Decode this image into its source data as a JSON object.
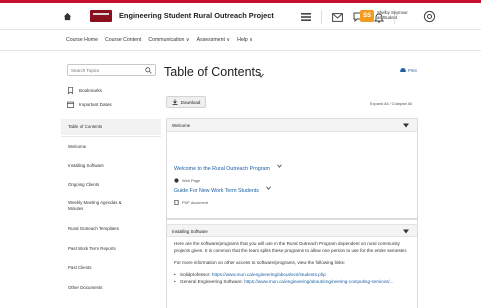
{
  "navbar": {
    "course_title": "Engineering Student Rural Outreach Project",
    "user_badge": "SS",
    "user_name": "Shelby Seymour",
    "user_role": "as Student"
  },
  "course_nav": {
    "items": [
      "Course Home",
      "Course Content",
      "Communication ∨",
      "Assessment ∨",
      "Help ∨"
    ]
  },
  "sidebar": {
    "search_placeholder": "Search Topics",
    "bookmarks": "Bookmarks",
    "important_dates": "Important Dates",
    "items": [
      {
        "label": "Table of Contents",
        "active": true
      },
      {
        "label": "Welcome"
      },
      {
        "label": "Installing Software"
      },
      {
        "label": "Ongoing Clients"
      },
      {
        "label": "Weekly Meeting Agendas & Minutes"
      },
      {
        "label": "Rural Outreach Templates"
      },
      {
        "label": "Past Work Term Reports"
      },
      {
        "label": "Past Clients"
      },
      {
        "label": "Other Documents"
      }
    ]
  },
  "main": {
    "title": "Table of Contents",
    "print": "Print",
    "download": "Download",
    "expand_collapse": "Expand All / Collapse All",
    "modules": [
      {
        "title": "Welcome",
        "topics": [
          {
            "title": "Welcome to the Rural Outreach Program",
            "meta": "Web Page"
          },
          {
            "title": "Guide For New Work Term Students",
            "meta": "PDF document"
          }
        ]
      },
      {
        "title": "Installing Software",
        "paragraph1": "Here are the software/programs that you will use in the Rural Outreach Program dependent on rural community projects given. It is common that the team splits these programs to allow one person to use for the entire semester.",
        "paragraph2": "For more information on other access to software/programs, view the following links:",
        "bullets": [
          {
            "label": "Solidprofessor:",
            "link": "https://www.mun.ca/engineering/about/ecs/students.php"
          },
          {
            "label": "General Engineering Software:",
            "link": "https://www.mun.ca/engineering/about/engineering-computing-services/..."
          }
        ]
      }
    ]
  },
  "colors": {
    "brand_red": "#c8102e",
    "link_blue": "#1b5fa6",
    "badge_orange": "#f39b1f"
  }
}
